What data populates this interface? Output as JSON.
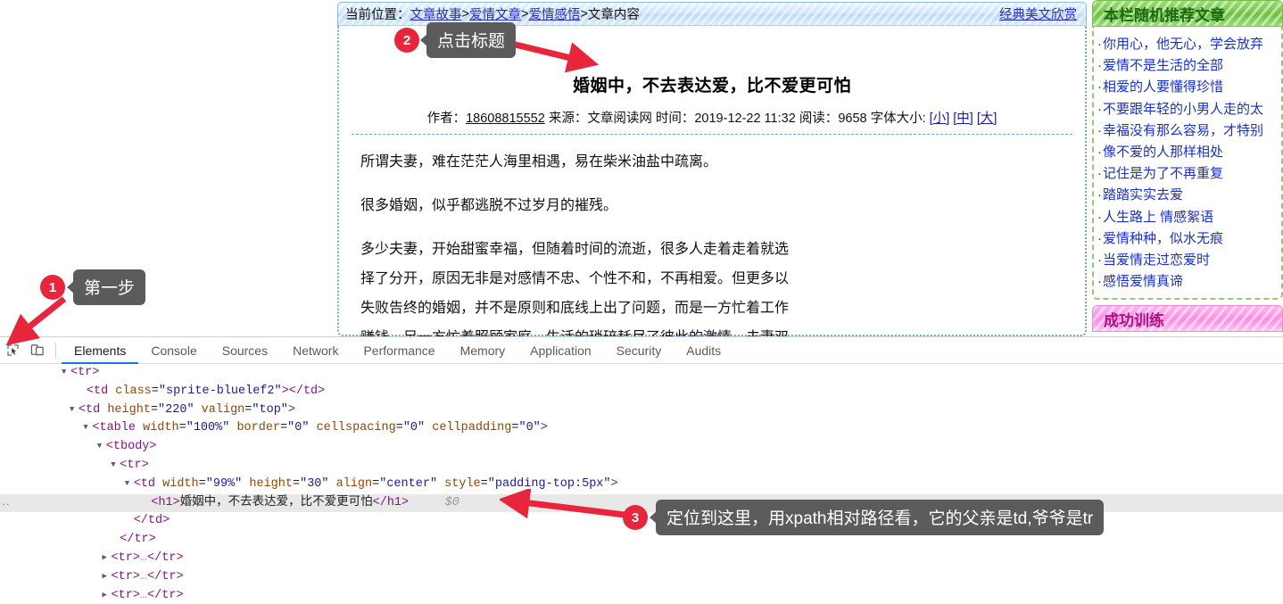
{
  "page": {
    "breadcrumb": {
      "label": "当前位置：",
      "links": [
        "文章故事",
        "爱情文章",
        "爱情感悟"
      ],
      "separator": ">",
      "current": "文章内容",
      "right_link": "经典美文欣赏"
    },
    "article": {
      "title": "婚姻中，不去表达爱，比不爱更可怕",
      "meta": {
        "author_label": "作者：",
        "author": "18608815552",
        "source_label": "来源：",
        "source": "文章阅读网",
        "time_label": "时间：",
        "time": "2019-12-22 11:32",
        "reads_label": "阅读：",
        "reads": "9658",
        "fontsize_label": "字体大小:",
        "size_small": "[小]",
        "size_medium": "[中]",
        "size_large": "[大]"
      },
      "paragraphs": [
        "所谓夫妻，难在茫茫人海里相遇，易在柴米油盐中疏离。",
        "很多婚姻，似乎都逃脱不过岁月的摧残。",
        "多少夫妻，开始甜蜜幸福，但随着时间的流逝，很多人走着走着就选择了分开，原因无非是对感情不忠、个性不和，不再相爱。但更多以失败告终的婚姻，并不是原则和底线上出了问题，而是一方忙着工作赚钱，另一方忙着照顾家庭，生活的琐碎耗尽了彼此的激情，夫妻双方在平淡的生活中不再去表达对彼此的爱，以为相互理解，实则渐行渐远。"
      ]
    },
    "sidebar": {
      "panels": [
        {
          "title": "本栏随机推荐文章",
          "theme": "green",
          "items": [
            "你用心，他无心，学会放弃",
            "爱情不是生活的全部",
            "相爱的人要懂得珍惜",
            "不要跟年轻的小男人走的太",
            "幸福没有那么容易，才特别",
            "像不爱的人那样相处",
            "记住是为了不再重复",
            "踏踏实实去爱",
            "人生路上 情感絮语",
            "爱情种种，似水无痕",
            "当爱情走过恋爱时",
            "感悟爱情真谛"
          ]
        },
        {
          "title": "成功训练",
          "theme": "pink",
          "items": []
        }
      ]
    }
  },
  "devtools": {
    "icons": {
      "inspect": "inspect-element-icon",
      "device": "device-toolbar-icon"
    },
    "tabs": [
      {
        "label": "Elements",
        "active": true
      },
      {
        "label": "Console",
        "active": false
      },
      {
        "label": "Sources",
        "active": false
      },
      {
        "label": "Network",
        "active": false
      },
      {
        "label": "Performance",
        "active": false
      },
      {
        "label": "Memory",
        "active": false
      },
      {
        "label": "Application",
        "active": false
      },
      {
        "label": "Security",
        "active": false
      },
      {
        "label": "Audits",
        "active": false
      }
    ],
    "dom_rows": [
      {
        "indent": 7.5,
        "tri": "open",
        "html": "<span class=\"punct\">&lt;</span><span class=\"tag\">tr</span><span class=\"punct\">&gt;</span>"
      },
      {
        "indent": 9.7,
        "tri": "none",
        "html": "<span class=\"punct\">&lt;</span><span class=\"tag\">td</span> <span class=\"attr\">class</span>=<span class=\"val\">\"sprite-bluelef2\"</span><span class=\"punct\">&gt;&lt;/</span><span class=\"tag\">td</span><span class=\"punct\">&gt;</span>"
      },
      {
        "indent": 8.6,
        "tri": "open",
        "html": "<span class=\"punct\">&lt;</span><span class=\"tag\">td</span> <span class=\"attr\">height</span>=<span class=\"val\">\"220\"</span> <span class=\"attr\">valign</span>=<span class=\"val\">\"top\"</span><span class=\"punct\">&gt;</span>"
      },
      {
        "indent": 10.5,
        "tri": "open",
        "html": "<span class=\"punct\">&lt;</span><span class=\"tag\">table</span> <span class=\"attr\">width</span>=<span class=\"val\">\"100%\"</span> <span class=\"attr\">border</span>=<span class=\"val\">\"0\"</span> <span class=\"attr\">cellspacing</span>=<span class=\"val\">\"0\"</span> <span class=\"attr\">cellpadding</span>=<span class=\"val\">\"0\"</span><span class=\"punct\">&gt;</span>"
      },
      {
        "indent": 12.4,
        "tri": "open",
        "html": "<span class=\"punct\">&lt;</span><span class=\"tag\">tbody</span><span class=\"punct\">&gt;</span>"
      },
      {
        "indent": 14.3,
        "tri": "open",
        "html": "<span class=\"punct\">&lt;</span><span class=\"tag\">tr</span><span class=\"punct\">&gt;</span>"
      },
      {
        "indent": 16.2,
        "tri": "open",
        "html": "<span class=\"punct\">&lt;</span><span class=\"tag\">td</span> <span class=\"attr\">width</span>=<span class=\"val\">\"99%\"</span> <span class=\"attr\">height</span>=<span class=\"val\">\"30\"</span> <span class=\"attr\">align</span>=<span class=\"val\">\"center\"</span> <span class=\"attr\">style</span>=<span class=\"val\">\"padding-top:5px\"</span><span class=\"punct\">&gt;</span>"
      },
      {
        "indent": 18.6,
        "tri": "none",
        "selected": true,
        "ellipsis": true,
        "html": "<span class=\"punct\">&lt;</span><span class=\"tag\">h1</span><span class=\"punct\">&gt;</span><span class=\"txt-node\">婚姻中，不去表达爱，比不爱更可怕</span><span class=\"punct\">&lt;/</span><span class=\"tag\">h1</span><span class=\"punct\">&gt;</span>&nbsp;&nbsp;&nbsp;&nbsp;&nbsp;<span class=\"dollar\">$0</span>"
      },
      {
        "indent": 16.2,
        "tri": "none",
        "html": "<span class=\"punct\">&lt;/</span><span class=\"tag\">td</span><span class=\"punct\">&gt;</span>"
      },
      {
        "indent": 14.3,
        "tri": "none",
        "html": "<span class=\"punct\">&lt;/</span><span class=\"tag\">tr</span><span class=\"punct\">&gt;</span>"
      },
      {
        "indent": 13.1,
        "tri": "closed",
        "html": "<span class=\"punct\">&lt;</span><span class=\"tag\">tr</span><span class=\"punct\">&gt;</span><span class=\"gray-ell\">…</span><span class=\"punct\">&lt;/</span><span class=\"tag\">tr</span><span class=\"punct\">&gt;</span>"
      },
      {
        "indent": 13.1,
        "tri": "closed",
        "html": "<span class=\"punct\">&lt;</span><span class=\"tag\">tr</span><span class=\"punct\">&gt;</span><span class=\"gray-ell\">…</span><span class=\"punct\">&lt;/</span><span class=\"tag\">tr</span><span class=\"punct\">&gt;</span>"
      },
      {
        "indent": 13.1,
        "tri": "closed",
        "html": "<span class=\"punct\">&lt;</span><span class=\"tag\">tr</span><span class=\"punct\">&gt;</span><span class=\"gray-ell\">…</span><span class=\"punct\">&lt;/</span><span class=\"tag\">tr</span><span class=\"punct\">&gt;</span>"
      }
    ]
  },
  "annotations": [
    {
      "number": "1",
      "text": "第一步"
    },
    {
      "number": "2",
      "text": "点击标题"
    },
    {
      "number": "3",
      "text": "定位到这里，用xpath相对路径看，它的父亲是td,爷爷是tr"
    }
  ],
  "colors": {
    "badge": "#e8253a",
    "callout_bg": "#5b5b5b",
    "arrow": "#e8253a",
    "devtools_active_tab": "#1a73e8",
    "link": "#1a2fd0"
  }
}
